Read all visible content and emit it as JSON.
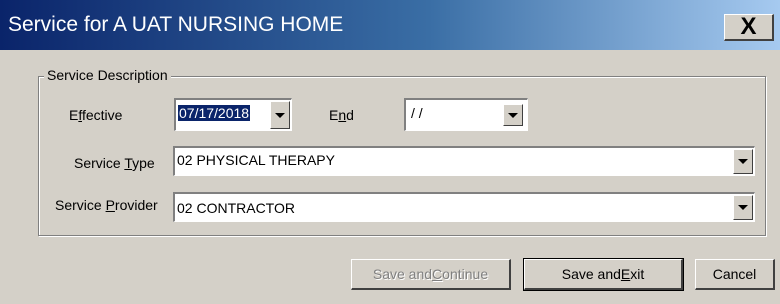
{
  "window": {
    "title": "Service for A UAT NURSING HOME",
    "close_glyph": "X"
  },
  "group": {
    "legend": "Service Description"
  },
  "fields": {
    "effective": {
      "label_pre": "E",
      "label_u": "f",
      "label_post": "fective",
      "value": "07/17/2018"
    },
    "end": {
      "label_pre": "E",
      "label_u": "n",
      "label_post": "d",
      "value": "/ /"
    },
    "service_type": {
      "label_pre": "Service ",
      "label_u": "T",
      "label_post": "ype",
      "value": "02 PHYSICAL THERAPY"
    },
    "service_provider": {
      "label_pre": "Service ",
      "label_u": "P",
      "label_post": "rovider",
      "value": "02  CONTRACTOR"
    }
  },
  "buttons": {
    "save_continue": {
      "pre": "Save and ",
      "u": "C",
      "post": "ontinue",
      "enabled": false
    },
    "save_exit": {
      "pre": "Save and ",
      "u": "E",
      "post": "xit",
      "enabled": true
    },
    "cancel": {
      "label": "Cancel",
      "enabled": true
    }
  },
  "icons": {
    "dropdown": "chevron-down-icon",
    "close": "close-icon"
  }
}
